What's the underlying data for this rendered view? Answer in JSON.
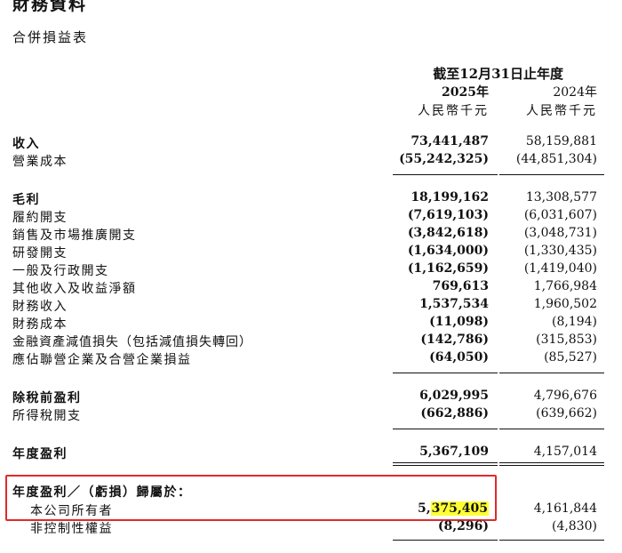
{
  "section_title": "財務資料",
  "statement_title": "合併損益表",
  "header": {
    "period": "截至12月31日止年度",
    "year_2025": "2025年",
    "year_2024": "2024年",
    "unit_2025": "人民幣千元",
    "unit_2024": "人民幣千元"
  },
  "rows": {
    "revenue": {
      "label": "收入",
      "v2025": "73,441,487",
      "v2024": "58,159,881"
    },
    "cost_of_revenue": {
      "label": "營業成本",
      "v2025": "(55,242,325)",
      "v2024": "(44,851,304)"
    },
    "gross_profit": {
      "label": "毛利",
      "v2025": "18,199,162",
      "v2024": "13,308,577"
    },
    "fulfillment": {
      "label": "履約開支",
      "v2025": "(7,619,103)",
      "v2024": "(6,031,607)"
    },
    "selling_marketing": {
      "label": "銷售及市場推廣開支",
      "v2025": "(3,842,618)",
      "v2024": "(3,048,731)"
    },
    "rnd": {
      "label": "研發開支",
      "v2025": "(1,634,000)",
      "v2024": "(1,330,435)"
    },
    "general_admin": {
      "label": "一般及行政開支",
      "v2025": "(1,162,659)",
      "v2024": "(1,419,040)"
    },
    "other_income": {
      "label": "其他收入及收益淨額",
      "v2025": "769,613",
      "v2024": "1,766,984"
    },
    "finance_income": {
      "label": "財務收入",
      "v2025": "1,537,534",
      "v2024": "1,960,502"
    },
    "finance_costs": {
      "label": "財務成本",
      "v2025": "(11,098)",
      "v2024": "(8,194)"
    },
    "impairment": {
      "label": "金融資產減值損失（包括減值損失轉回）",
      "v2025": "(142,786)",
      "v2024": "(315,853)"
    },
    "share_of_associates": {
      "label": "應佔聯營企業及合營企業損益",
      "v2025": "(64,050)",
      "v2024": "(85,527)"
    },
    "pbt": {
      "label": "除稅前盈利",
      "v2025": "6,029,995",
      "v2024": "4,796,676"
    },
    "tax": {
      "label": "所得稅開支",
      "v2025": "(662,886)",
      "v2024": "(639,662)"
    },
    "profit_for_year": {
      "label": "年度盈利",
      "v2025": "5,367,109",
      "v2024": "4,157,014"
    },
    "attributable_heading": {
      "label": "年度盈利／（虧損）歸屬於："
    },
    "owners": {
      "label": "本公司所有者",
      "v2025_prefix": "5,",
      "v2025_highlight": "375,405",
      "v2024": "4,161,844"
    },
    "nci": {
      "label": "非控制性權益",
      "v2025": "(8,296)",
      "v2024": "(4,830)"
    }
  },
  "colors": {
    "highlight_box": "#e02a2a",
    "highlight_fill": "#ffff33"
  }
}
